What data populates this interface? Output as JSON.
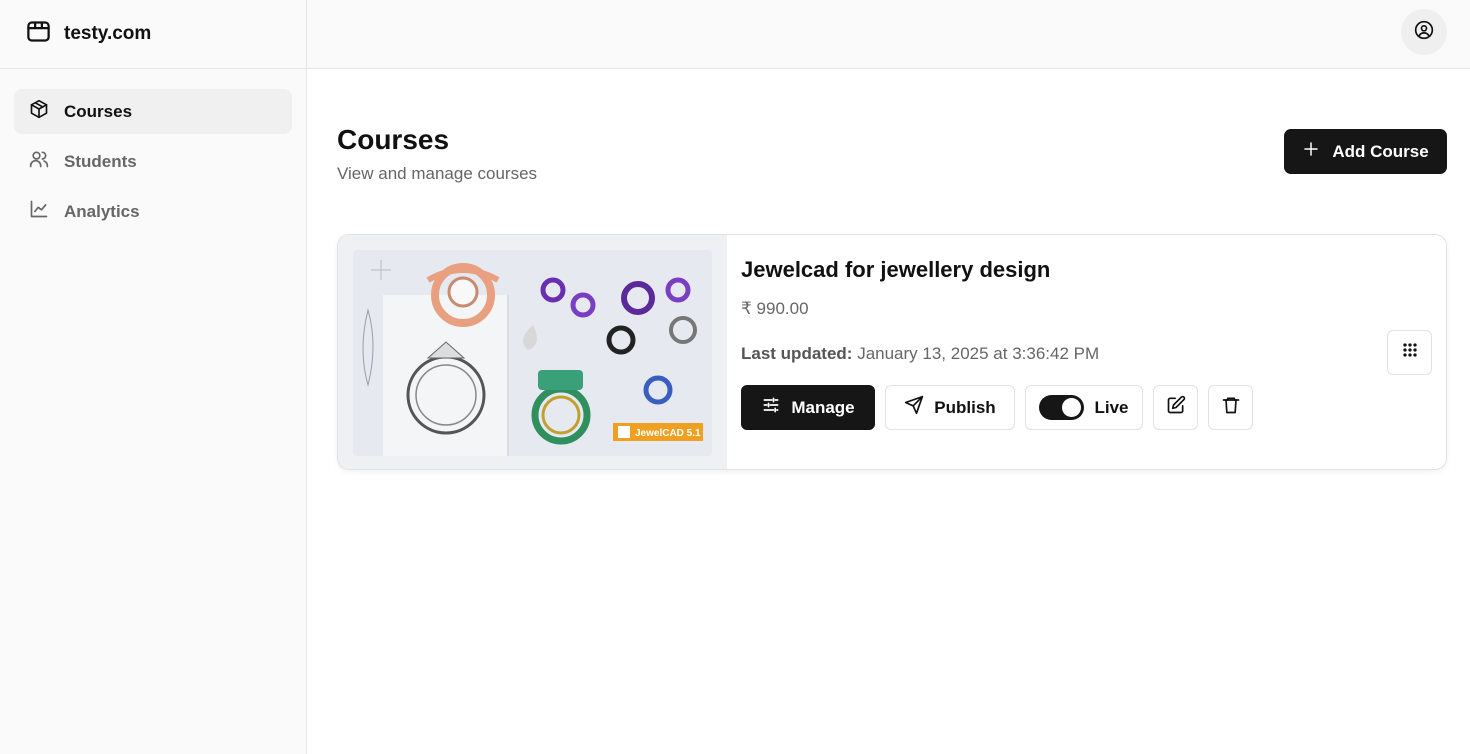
{
  "brand": {
    "name": "testy.com",
    "icon": "store-icon"
  },
  "sidebar": {
    "items": [
      {
        "label": "Courses",
        "icon": "package-icon",
        "active": true
      },
      {
        "label": "Students",
        "icon": "users-icon",
        "active": false
      },
      {
        "label": "Analytics",
        "icon": "chart-line-icon",
        "active": false
      }
    ]
  },
  "topbar": {
    "avatar_icon": "user-circle-icon"
  },
  "page": {
    "title": "Courses",
    "subtitle": "View and manage courses",
    "add_button_label": "Add Course"
  },
  "course": {
    "title": "Jewelcad for jewellery design",
    "price": "₹ 990.00",
    "updated_label": "Last updated:",
    "updated_value": "January 13, 2025 at 3:36:42 PM",
    "thumbnail_badge": "JewelCAD 5.1",
    "actions": {
      "manage": "Manage",
      "publish": "Publish",
      "live": "Live",
      "live_enabled": true
    }
  },
  "colors": {
    "primary": "#161616",
    "muted_text": "#666666",
    "sidebar_bg": "#fafafa",
    "border": "#e5e5e5"
  }
}
